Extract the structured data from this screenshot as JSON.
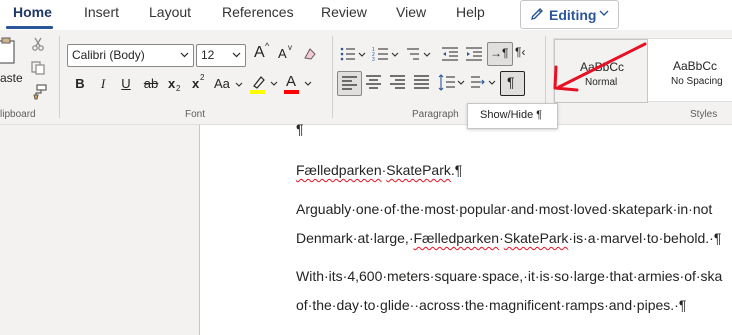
{
  "tabs": [
    "Home",
    "Insert",
    "Layout",
    "References",
    "Review",
    "View",
    "Help"
  ],
  "editing_label": "Editing",
  "clipboard": {
    "paste_label": "aste",
    "group_label": "lipboard"
  },
  "font": {
    "family": "Calibri (Body)",
    "size": "12",
    "group_label": "Font",
    "grow": "A",
    "shrink": "A",
    "bold": "B",
    "italic": "I",
    "underline": "U",
    "strike": "ab",
    "subscript": "x",
    "superscript": "x",
    "change_case": "Aa",
    "font_color_letter": "A"
  },
  "paragraph": {
    "group_label": "Paragraph"
  },
  "styles": {
    "normal_preview": "AaBbCc",
    "normal_label": "Normal",
    "nospacing_preview": "AaBbCc",
    "nospacing_label": "No Spacing",
    "group_label": "Styles"
  },
  "tooltip": "Show/Hide ¶",
  "colors": {
    "accent": "#2b579a",
    "highlight": "#ffff00",
    "font_color": "#ff0000",
    "arrow": "#e81123"
  },
  "document": {
    "pilcrow_line": "¶",
    "title_a": "Fælledparken",
    "title_sep": "·",
    "title_b": "SkatePark",
    "title_end": ".¶",
    "p1_l1": "Arguably·one·of·the·most·popular·and·most·loved·skatepark·in·not",
    "p1_l2_a": "Denmark·at·large,·",
    "p1_l2_b": "Fælledparken",
    "p1_l2_c": "·",
    "p1_l2_d": "SkatePark",
    "p1_l2_e": "·is·a·marvel·to·behold.·¶",
    "p2_l1": "With·its·4,600·meters·square·space,·it·is·so·large·that·armies·of·ska",
    "p2_l2": "of·the·day·to·glide··across·the·magnificent·ramps·and·pipes.·¶"
  }
}
